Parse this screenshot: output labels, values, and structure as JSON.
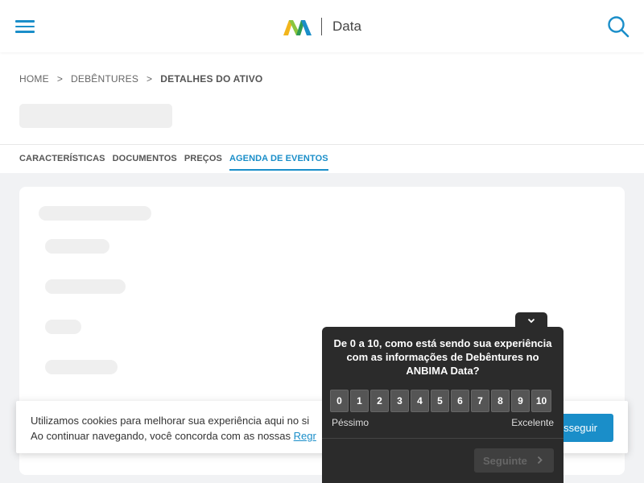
{
  "header": {
    "brand_text": "Data",
    "menu_icon": "hamburger-menu-icon",
    "search_icon": "search-icon",
    "accent_color": "#1a8ec9"
  },
  "breadcrumb": {
    "items": [
      "HOME",
      "DEBÊNTURES",
      "DETALHES DO ATIVO"
    ],
    "separator": ">"
  },
  "tabs": [
    {
      "label": "CARACTERÍSTICAS",
      "active": false
    },
    {
      "label": "DOCUMENTOS",
      "active": false
    },
    {
      "label": "PREÇOS",
      "active": false
    },
    {
      "label": "AGENDA DE EVENTOS",
      "active": true
    }
  ],
  "cookie": {
    "line1": "Utilizamos cookies para melhorar sua experiência aqui no si",
    "line2": "Ao continuar navegando, você concorda com as nossas ",
    "link_text": "Regr",
    "button_label": "sseguir"
  },
  "survey": {
    "question": "De 0 a 10, como está sendo sua experiência com as informações de Debêntures no ANBIMA Data?",
    "scale": [
      "0",
      "1",
      "2",
      "3",
      "4",
      "5",
      "6",
      "7",
      "8",
      "9",
      "10"
    ],
    "low_label": "Péssimo",
    "high_label": "Excelente",
    "next_label": "Seguinte",
    "toggle_icon": "chevron-down-icon"
  }
}
